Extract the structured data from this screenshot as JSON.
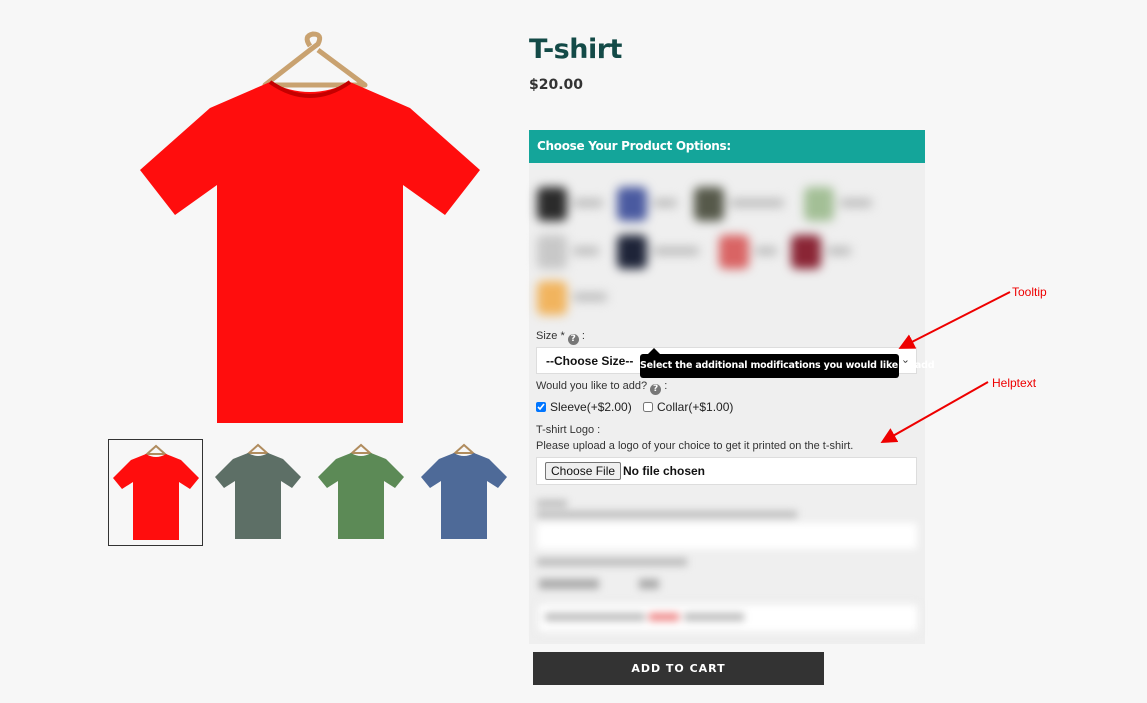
{
  "product": {
    "title": "T-shirt",
    "price": "$20.00",
    "main_image_color": "#ff0d0d",
    "thumbnails": [
      {
        "color": "#ff0d0d"
      },
      {
        "color": "#5d6f66"
      },
      {
        "color": "#5c8a56"
      },
      {
        "color": "#4e6a98"
      }
    ]
  },
  "options": {
    "header": "Choose Your Product Options:",
    "size_label": "Size * ",
    "size_placeholder": "--Choose Size--",
    "addons_label": "Would you like to add? ",
    "addons": [
      {
        "label": "Sleeve(+$2.00)",
        "checked": true
      },
      {
        "label": "Collar(+$1.00)",
        "checked": false
      }
    ],
    "logo_label": "T-shirt Logo :",
    "logo_helptext": "Please upload a logo of your choice to get it printed on the t-shirt.",
    "file_button": "Choose File",
    "file_status": "No file chosen",
    "tooltip": "Select the additional modifications you would like to add"
  },
  "add_to_cart": "ADD TO CART",
  "annotations": {
    "tooltip": "Tooltip",
    "helptext": "Helptext",
    "color": "#e00000"
  },
  "colors": {
    "accent": "#14a59a",
    "title": "#134a47",
    "button": "#333333"
  }
}
